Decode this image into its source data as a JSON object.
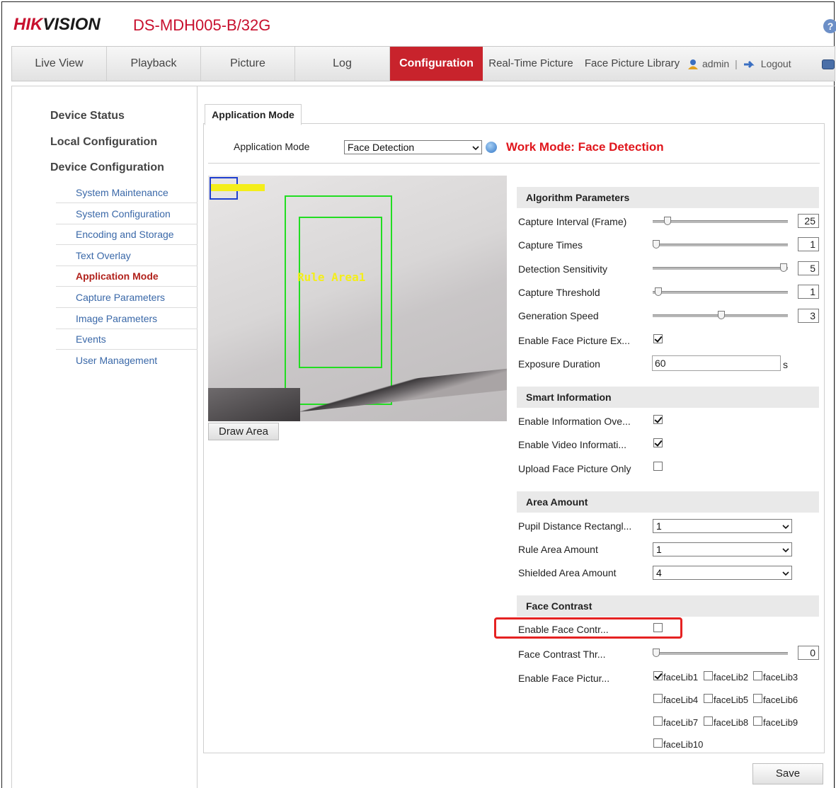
{
  "header": {
    "logo_hik": "HIK",
    "logo_vision": "VISION",
    "model": "DS-MDH005-B/32G",
    "help": "?"
  },
  "nav": {
    "tabs": [
      "Live View",
      "Playback",
      "Picture",
      "Log",
      "Configuration",
      "Real-Time Picture",
      "Face Picture Library"
    ],
    "active_tab": "Configuration",
    "user": "admin",
    "separator": "|",
    "logout": "Logout"
  },
  "sidebar": {
    "main": [
      "Device Status",
      "Local Configuration",
      "Device Configuration"
    ],
    "sub": [
      "System Maintenance",
      "System Configuration",
      "Encoding and Storage",
      "Text Overlay",
      "Application Mode",
      "Capture Parameters",
      "Image Parameters",
      "Events",
      "User Management"
    ],
    "active_sub": "Application Mode"
  },
  "panel": {
    "tab": "Application Mode",
    "mode_label": "Application Mode",
    "mode_value": "Face Detection",
    "work_mode": "Work Mode: Face Detection"
  },
  "video": {
    "rule_label": "Rule Area1",
    "draw_button": "Draw Area"
  },
  "algorithm": {
    "title": "Algorithm Parameters",
    "rows": [
      {
        "label": "Capture Interval (Frame)",
        "value": "25",
        "level": 0.08
      },
      {
        "label": "Capture Times",
        "value": "1",
        "level": 0.0
      },
      {
        "label": "Detection Sensitivity",
        "value": "5",
        "level": 1.0
      },
      {
        "label": "Capture Threshold",
        "value": "1",
        "level": 0.03
      },
      {
        "label": "Generation Speed",
        "value": "3",
        "level": 0.5
      }
    ],
    "exposure_enable_label": "Enable Face Picture Ex...",
    "exposure_enable": true,
    "exposure_duration_label": "Exposure Duration",
    "exposure_duration": "60",
    "exposure_unit": "s"
  },
  "smart": {
    "title": "Smart Information",
    "rows": [
      {
        "label": "Enable Information Ove...",
        "checked": true
      },
      {
        "label": "Enable Video Informati...",
        "checked": true
      },
      {
        "label": "Upload Face Picture Only",
        "checked": false
      }
    ]
  },
  "area": {
    "title": "Area Amount",
    "rows": [
      {
        "label": "Pupil Distance Rectangl...",
        "value": "1"
      },
      {
        "label": "Rule Area Amount",
        "value": "1"
      },
      {
        "label": "Shielded Area Amount",
        "value": "4"
      }
    ]
  },
  "contrast": {
    "title": "Face Contrast",
    "enable_label": "Enable Face Contr...",
    "enable": false,
    "threshold_label": "Face Contrast Thr...",
    "threshold": "0",
    "threshold_level": 0.0,
    "libs_label": "Enable Face Pictur...",
    "libs": [
      {
        "name": "faceLib1",
        "checked": true
      },
      {
        "name": "faceLib2",
        "checked": false
      },
      {
        "name": "faceLib3",
        "checked": false
      },
      {
        "name": "faceLib4",
        "checked": false
      },
      {
        "name": "faceLib5",
        "checked": false
      },
      {
        "name": "faceLib6",
        "checked": false
      },
      {
        "name": "faceLib7",
        "checked": false
      },
      {
        "name": "faceLib8",
        "checked": false
      },
      {
        "name": "faceLib9",
        "checked": false
      },
      {
        "name": "faceLib10",
        "checked": false
      }
    ]
  },
  "save_label": "Save",
  "colors": {
    "brand_red": "#c8102e",
    "active_tab": "#c8232c",
    "work_mode": "#e0161c",
    "link_blue": "#3a68a8",
    "highlight": "#e52222"
  }
}
